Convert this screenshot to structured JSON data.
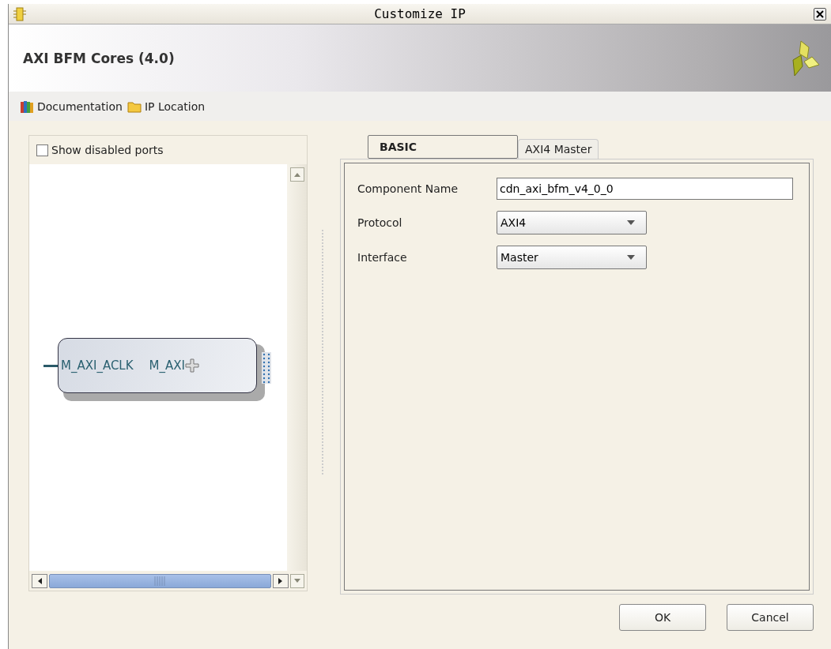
{
  "window": {
    "title": "Customize IP"
  },
  "header": {
    "title": "AXI BFM Cores (4.0)"
  },
  "toolbar": [
    {
      "label": "Documentation",
      "kind": "books"
    },
    {
      "label": "IP Location",
      "kind": "folder"
    }
  ],
  "port_panel": {
    "show_disabled_ports": {
      "label": "Show disabled ports",
      "checked": false
    },
    "block": {
      "input_port": "M_AXI_ACLK",
      "output_port": "M_AXI"
    }
  },
  "tabs": [
    {
      "label": "BASIC",
      "selected": true
    },
    {
      "label": "AXI4 Master",
      "selected": false
    }
  ],
  "fields": [
    {
      "label": "Component Name",
      "kind": "text",
      "value": "cdn_axi_bfm_v4_0_0"
    },
    {
      "label": "Protocol",
      "kind": "select",
      "value": "AXI4"
    },
    {
      "label": "Interface",
      "kind": "select",
      "value": "Master"
    }
  ],
  "buttons": [
    "OK",
    "Cancel"
  ]
}
